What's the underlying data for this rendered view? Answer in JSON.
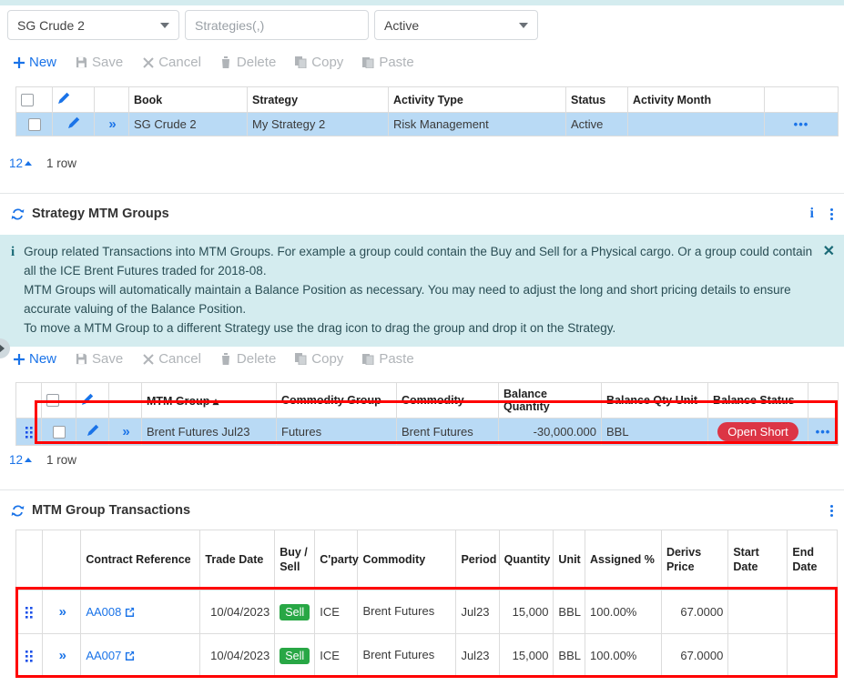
{
  "filters": {
    "book_value": "SG Crude 2",
    "strategies_placeholder": "Strategies(,)",
    "strategies_value": "",
    "status_value": "Active"
  },
  "toolbar": {
    "new": "New",
    "save": "Save",
    "cancel": "Cancel",
    "delete": "Delete",
    "copy": "Copy",
    "paste": "Paste"
  },
  "strategies_grid": {
    "columns": [
      "",
      "",
      "",
      "Book",
      "Strategy",
      "Activity Type",
      "Status",
      "Activity Month",
      ""
    ],
    "rows": [
      {
        "book": "SG Crude 2",
        "strategy": "My Strategy 2",
        "activity_type": "Risk Management",
        "status": "Active",
        "activity_month": ""
      }
    ],
    "footer": {
      "page_size": "12",
      "row_count": "1 row"
    }
  },
  "mtm_groups_section": {
    "title": "Strategy MTM Groups",
    "banner": {
      "line1": "Group related Transactions into MTM Groups. For example a group could contain the Buy and Sell for a Physical cargo. Or a group could contain all the ICE Brent Futures traded for 2018-08.",
      "line2": "MTM Groups will automatically maintain a Balance Position as necessary. You may need to adjust the long and short pricing details to ensure accurate valuing of the Balance Position.",
      "line3": "To move a MTM Group to a different Strategy use the drag icon to drag the group and drop it on the Strategy.",
      "close": "✕"
    },
    "columns": [
      "",
      "",
      "",
      "",
      "MTM Group ▴",
      "Commodity Group",
      "Commodity",
      "Balance Quantity",
      "Balance Qty Unit",
      "Balance Status",
      ""
    ],
    "rows": [
      {
        "mtm_group": "Brent Futures Jul23",
        "commodity_group": "Futures",
        "commodity": "Brent Futures",
        "balance_quantity": "-30,000.000",
        "balance_qty_unit": "BBL",
        "balance_status": "Open Short"
      }
    ],
    "footer": {
      "page_size": "12",
      "row_count": "1 row"
    }
  },
  "transactions_section": {
    "title": "MTM Group Transactions",
    "columns": [
      "",
      "",
      "Contract Reference",
      "Trade Date",
      "Buy / Sell",
      "C'party",
      "Commodity",
      "Period",
      "Quantity",
      "Unit",
      "Assigned %",
      "Derivs Price",
      "Start Date",
      "End Date"
    ],
    "rows": [
      {
        "contract_reference": "AA008",
        "trade_date": "10/04/2023",
        "buy_sell": "Sell",
        "cparty": "ICE",
        "commodity": "Brent Futures",
        "period": "Jul23",
        "quantity": "15,000",
        "unit": "BBL",
        "assigned_pct": "100.00%",
        "derivs_price": "67.0000",
        "start_date": "",
        "end_date": ""
      },
      {
        "contract_reference": "AA007",
        "trade_date": "10/04/2023",
        "buy_sell": "Sell",
        "cparty": "ICE",
        "commodity": "Brent Futures",
        "period": "Jul23",
        "quantity": "15,000",
        "unit": "BBL",
        "assigned_pct": "100.00%",
        "derivs_price": "67.0000",
        "start_date": "",
        "end_date": ""
      }
    ]
  },
  "colors": {
    "accent": "#1a73e8",
    "banner_bg": "#d4ecef",
    "selected_row": "#b9daf5",
    "highlight": "#ff0000",
    "negative": "#e02020",
    "badge_red": "#dc3545",
    "badge_green": "#28a745"
  }
}
